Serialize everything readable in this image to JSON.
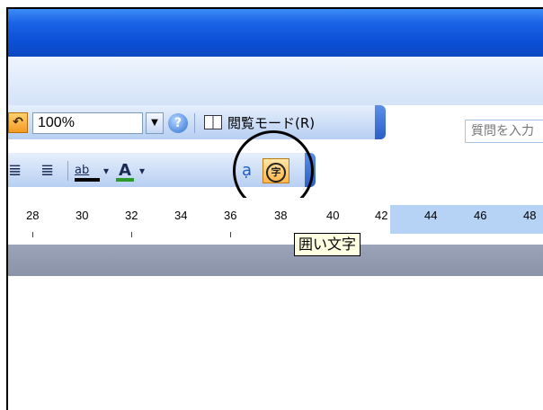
{
  "help_search": {
    "placeholder": "質問を入力"
  },
  "toolbar_standard": {
    "undo_glyph": "↶",
    "zoom_value": "100%",
    "zoom_arrow": "▼",
    "help_glyph": "?",
    "read_mode_label": "閲覧モード(R)"
  },
  "toolbar_format": {
    "indent_decrease_glyph": "≣",
    "indent_increase_glyph": "≣",
    "highlight_glyph": "ab",
    "font_color_glyph": "A",
    "dropdown_glyph": "▾",
    "phonetic_glyph": "ạ",
    "enclose_glyph": "字"
  },
  "ruler": {
    "ticks": [
      "28",
      "30",
      "32",
      "34",
      "36",
      "38",
      "40",
      "42",
      "44",
      "46",
      "48"
    ]
  },
  "tooltip": {
    "text": "囲い文字"
  },
  "colors": {
    "title_bar": "#0a4fd6",
    "highlight": "#ffb54a",
    "font_color": "#2a9a2a"
  }
}
